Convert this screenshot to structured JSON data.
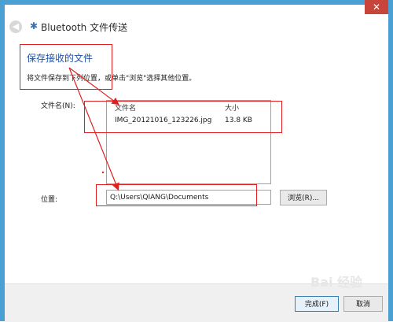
{
  "window": {
    "title": "Bluetooth 文件传送",
    "close_glyph": "✕",
    "back_glyph": "◀",
    "bt_glyph": "✱"
  },
  "content": {
    "heading": "保存接收的文件",
    "description": "将文件保存到下列位置，或单击\"浏览\"选择其他位置。",
    "files_label": "文件名(N):",
    "files": {
      "headers": [
        "文件名",
        "大小"
      ],
      "rows": [
        {
          "name": "IMG_20121016_123226.jpg",
          "size": "13.8 KB"
        }
      ]
    },
    "location_label": "位置:",
    "location_value": "Q:\\Users\\QIANG\\Documents",
    "browse_label": "浏览(R)..."
  },
  "footer": {
    "finish_label": "完成(F)",
    "cancel_label": "取消"
  },
  "colors": {
    "frame": "#4a9fd3",
    "heading": "#1f4fa5",
    "annotation": "#e02020"
  },
  "watermark": "Bai 经验"
}
